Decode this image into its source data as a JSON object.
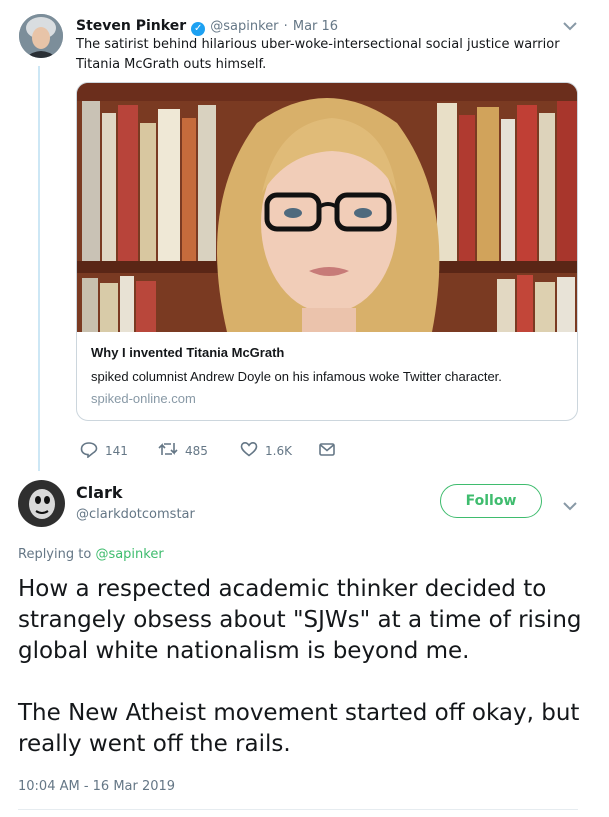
{
  "original_tweet": {
    "name": "Steven Pinker",
    "handle": "@sapinker",
    "separator": "·",
    "date": "Mar 16",
    "text": "The satirist behind hilarious uber-woke-intersectional social justice warrior Titania McGrath outs himself.",
    "card": {
      "title": "Why I invented Titania McGrath",
      "description": "spiked columnist Andrew Doyle on his infamous woke Twitter character.",
      "domain": "spiked-online.com"
    },
    "actions": {
      "replies": "141",
      "retweets": "485",
      "likes": "1.6K"
    }
  },
  "reply_tweet": {
    "name": "Clark",
    "handle": "@clarkdotcomstar",
    "follow_label": "Follow",
    "replying_prefix": "Replying to",
    "replying_to": "@sapinker",
    "text": "How a respected academic thinker decided to strangely obsess about \"SJWs\" at a time of rising global white nationalism is beyond me.\n\nThe New Atheist movement started off okay, but really went off the rails.",
    "timestamp": "10:04 AM - 16 Mar 2019"
  },
  "colors": {
    "twitter_blue": "#1da1f2",
    "follow_green": "#3fbc6e",
    "thread_line": "#cde7f5",
    "muted_text": "#657786"
  }
}
